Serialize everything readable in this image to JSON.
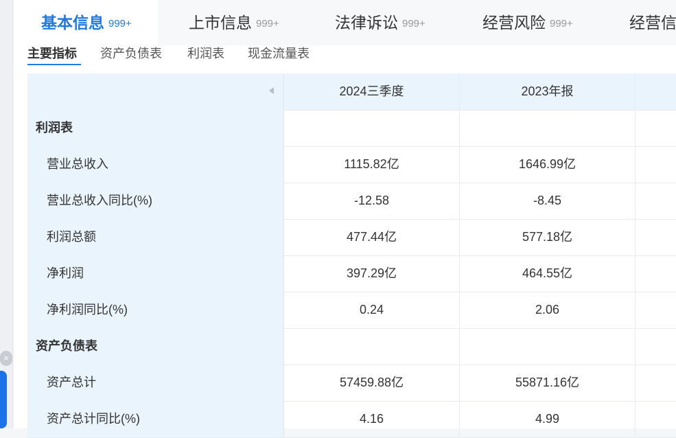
{
  "tabs": [
    {
      "label": "基本信息",
      "count": "999+",
      "active": true
    },
    {
      "label": "上市信息",
      "count": "999+"
    },
    {
      "label": "法律诉讼",
      "count": "999+"
    },
    {
      "label": "经营风险",
      "count": "999+"
    },
    {
      "label": "经营信息",
      "count": ""
    }
  ],
  "subtabs": [
    "主要指标",
    "资产负债表",
    "利润表",
    "现金流量表"
  ],
  "table": {
    "columns": [
      "2024三季度",
      "2023年报"
    ],
    "rows": [
      {
        "label": "利润表",
        "type": "section",
        "v1": "",
        "v2": ""
      },
      {
        "label": "营业总收入",
        "type": "item",
        "v1": "1115.82亿",
        "v2": "1646.99亿"
      },
      {
        "label": "营业总收入同比(%)",
        "type": "item",
        "v1": "-12.58",
        "v2": "-8.45"
      },
      {
        "label": "利润总额",
        "type": "item",
        "v1": "477.44亿",
        "v2": "577.18亿"
      },
      {
        "label": "净利润",
        "type": "item",
        "v1": "397.29亿",
        "v2": "464.55亿"
      },
      {
        "label": "净利润同比(%)",
        "type": "item",
        "v1": "0.24",
        "v2": "2.06"
      },
      {
        "label": "资产负债表",
        "type": "section",
        "v1": "",
        "v2": ""
      },
      {
        "label": "资产总计",
        "type": "item",
        "v1": "57459.88亿",
        "v2": "55871.16亿"
      },
      {
        "label": "资产总计同比(%)",
        "type": "item",
        "v1": "4.16",
        "v2": "4.99"
      }
    ]
  },
  "float": {
    "close_icon": "×"
  },
  "colors": {
    "accent": "#1f7ae0",
    "label_bg": "#eaf4fd"
  }
}
